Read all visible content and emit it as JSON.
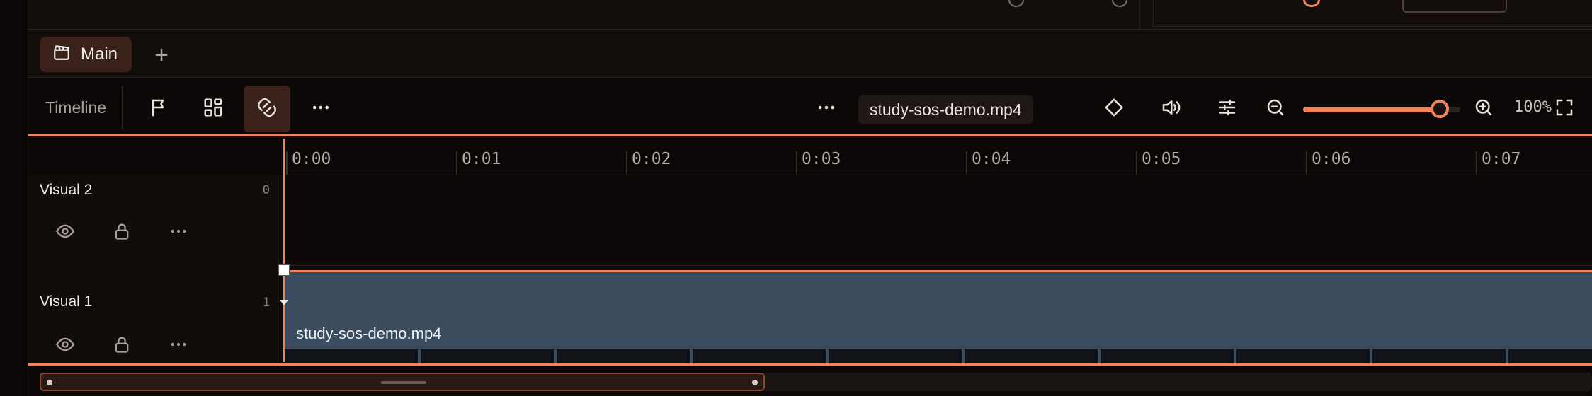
{
  "tabs": {
    "items": [
      {
        "label": "Main"
      }
    ],
    "add_label": "+"
  },
  "toolbar": {
    "title": "Timeline",
    "filename": "study-sos-demo.mp4",
    "zoom_label": "100%",
    "zoom_level": 0.87
  },
  "ruler": {
    "ticks": [
      "0:00",
      "0:01",
      "0:02",
      "0:03",
      "0:04",
      "0:05",
      "0:06",
      "0:07"
    ]
  },
  "tracks": [
    {
      "name": "Visual 2",
      "index": "0"
    },
    {
      "name": "Visual 1",
      "index": "1"
    }
  ],
  "clip": {
    "label": "study-sos-demo.mp4"
  },
  "colors": {
    "accent": "#f0845a",
    "clip": "#3a4c5e",
    "active_tab": "#3a211a",
    "background": "#0d0908"
  },
  "icons": {
    "tab": "clapperboard-icon",
    "toolbar_left": [
      "flag-icon",
      "layout-grid-icon",
      "magnet-icon",
      "more-horizontal-icon"
    ],
    "toolbar_right": [
      "more-horizontal-icon",
      "diamond-icon",
      "volume-icon",
      "sliders-icon",
      "zoom-out-icon",
      "zoom-in-icon",
      "fullscreen-icon"
    ],
    "track": [
      "eye-icon",
      "lock-icon",
      "more-horizontal-icon"
    ]
  }
}
